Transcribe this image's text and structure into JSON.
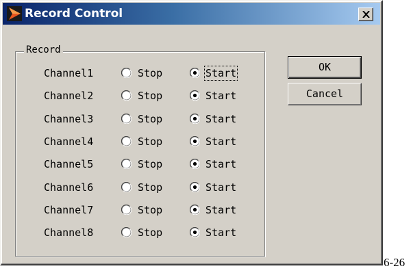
{
  "window": {
    "title": "Record Control",
    "close_label": "close"
  },
  "group": {
    "label": "Record"
  },
  "channels": [
    {
      "label": "Channel1",
      "stop_label": "Stop",
      "start_label": "Start",
      "selected": "Start",
      "focused": true
    },
    {
      "label": "Channel2",
      "stop_label": "Stop",
      "start_label": "Start",
      "selected": "Start",
      "focused": false
    },
    {
      "label": "Channel3",
      "stop_label": "Stop",
      "start_label": "Start",
      "selected": "Start",
      "focused": false
    },
    {
      "label": "Channel4",
      "stop_label": "Stop",
      "start_label": "Start",
      "selected": "Start",
      "focused": false
    },
    {
      "label": "Channel5",
      "stop_label": "Stop",
      "start_label": "Start",
      "selected": "Start",
      "focused": false
    },
    {
      "label": "Channel6",
      "stop_label": "Stop",
      "start_label": "Start",
      "selected": "Start",
      "focused": false
    },
    {
      "label": "Channel7",
      "stop_label": "Stop",
      "start_label": "Start",
      "selected": "Start",
      "focused": false
    },
    {
      "label": "Channel8",
      "stop_label": "Stop",
      "start_label": "Start",
      "selected": "Start",
      "focused": false
    }
  ],
  "buttons": {
    "ok_label": "OK",
    "cancel_label": "Cancel"
  },
  "figure_caption": "6-26",
  "icons": {
    "title_icon": "app-arrow-icon",
    "close_icon": "close-icon"
  },
  "colors": {
    "face": "#d4d0c8",
    "titlebar_start": "#0a246a",
    "titlebar_end": "#a6caf0",
    "title_icon_fill": "#e8561f"
  }
}
